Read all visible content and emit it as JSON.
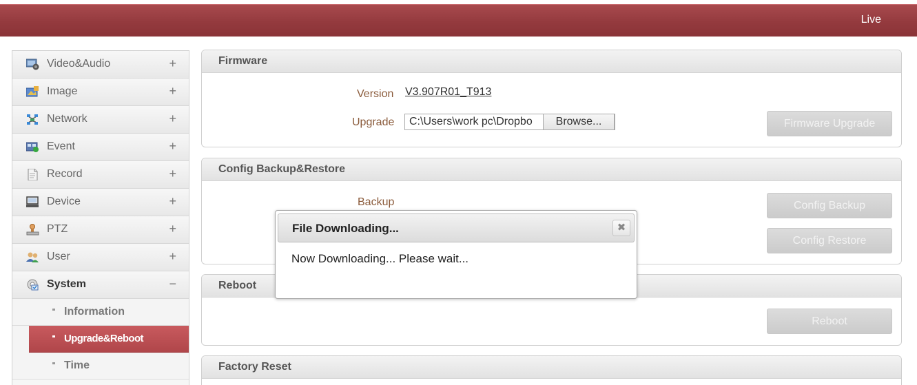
{
  "header": {
    "live_label": "Live"
  },
  "sidebar": {
    "items": [
      {
        "label": "Video&Audio",
        "toggle": "+",
        "icon": "video-audio-icon"
      },
      {
        "label": "Image",
        "toggle": "+",
        "icon": "image-icon"
      },
      {
        "label": "Network",
        "toggle": "+",
        "icon": "network-icon"
      },
      {
        "label": "Event",
        "toggle": "+",
        "icon": "event-icon"
      },
      {
        "label": "Record",
        "toggle": "+",
        "icon": "record-icon"
      },
      {
        "label": "Device",
        "toggle": "+",
        "icon": "device-icon"
      },
      {
        "label": "PTZ",
        "toggle": "+",
        "icon": "ptz-icon"
      },
      {
        "label": "User",
        "toggle": "+",
        "icon": "user-icon"
      },
      {
        "label": "System",
        "toggle": "−",
        "icon": "system-icon"
      }
    ],
    "submenu": [
      {
        "label": "Information"
      },
      {
        "label": "Upgrade&Reboot"
      },
      {
        "label": "Time"
      }
    ]
  },
  "firmware": {
    "title": "Firmware",
    "version_label": "Version",
    "version_value": "V3.907R01_T913",
    "upgrade_label": "Upgrade",
    "file_path": "C:\\Users\\work pc\\Dropbo",
    "browse_label": "Browse...",
    "upgrade_button": "Firmware Upgrade"
  },
  "config": {
    "title": "Config Backup&Restore",
    "backup_label": "Backup",
    "backup_button": "Config Backup",
    "restore_button": "Config Restore"
  },
  "reboot": {
    "title": "Reboot",
    "reboot_button": "Reboot"
  },
  "factory": {
    "title": "Factory Reset"
  },
  "dialog": {
    "title": "File Downloading...",
    "close_glyph": "✖",
    "message": "Now Downloading... Please wait..."
  },
  "colors": {
    "brand": "#9a3c40",
    "active_menu": "#bf5054",
    "label_brown": "#8a5a3a"
  }
}
